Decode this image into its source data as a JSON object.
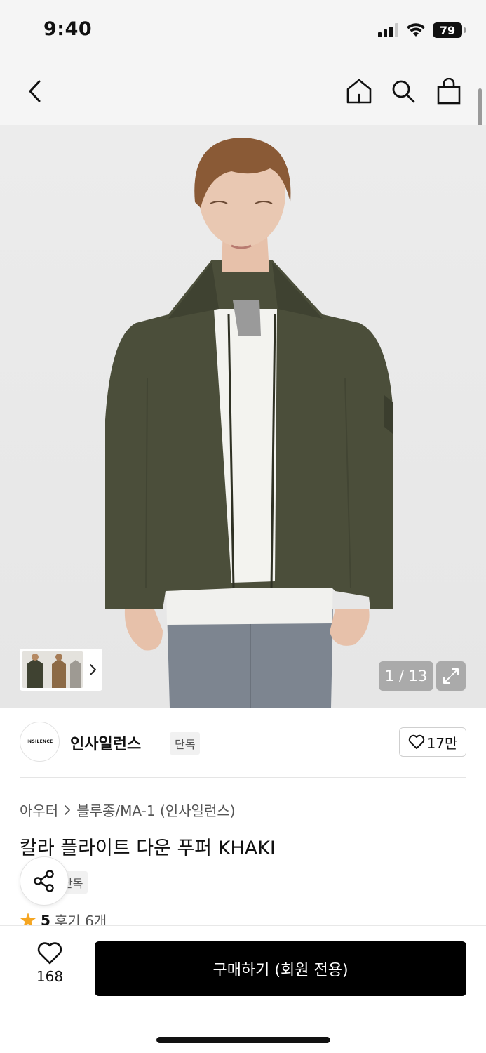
{
  "status_bar": {
    "time": "9:40",
    "battery": "79",
    "icons": [
      "signal-icon",
      "wifi-icon",
      "battery-icon"
    ]
  },
  "nav": {
    "icons": [
      "back-icon",
      "home-icon",
      "search-icon",
      "bag-icon"
    ]
  },
  "gallery": {
    "counter": "1 / 13",
    "icons": [
      "chevron-right-icon",
      "expand-icon"
    ]
  },
  "brand": {
    "logo_text": "INSILENCE",
    "name": "인사일런스",
    "tag": "단독",
    "likes": "17만"
  },
  "breadcrumb": {
    "category": "아우터",
    "subcategory": "블루종/MA-1 (인사일런스)"
  },
  "product": {
    "title": "칼라 플라이트 다운 푸퍼 KHAKI",
    "exclusive_tag": "단독"
  },
  "rating": {
    "score": "5",
    "reviews": "후기 6개"
  },
  "bottom": {
    "wish_count": "168",
    "buy_label": "구매하기 (회원 전용)"
  },
  "colors": {
    "accent_black": "#000000",
    "star": "#f5a623",
    "jacket": "#4b4e3a"
  }
}
